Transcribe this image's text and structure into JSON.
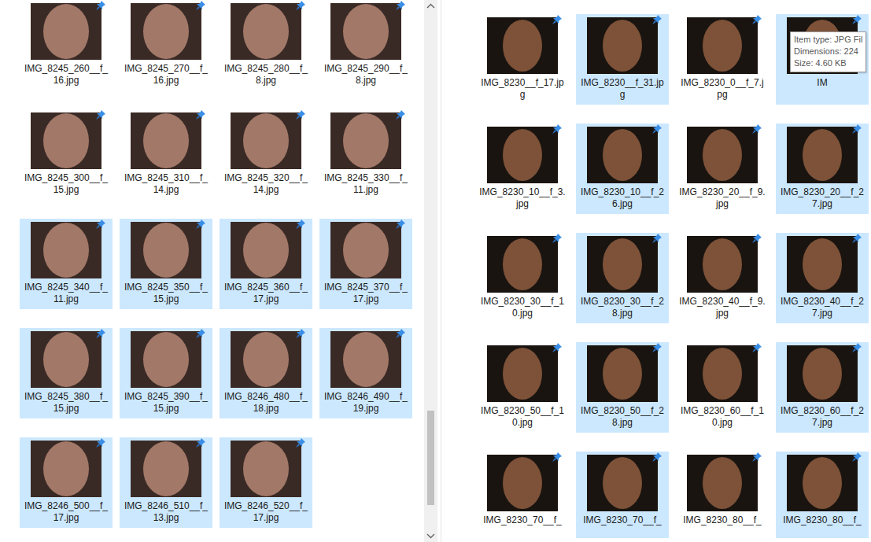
{
  "panes": [
    {
      "files": [
        {
          "name": "IMG_8245_260__f_16.jpg",
          "selected": false
        },
        {
          "name": "IMG_8245_270__f_16.jpg",
          "selected": false
        },
        {
          "name": "IMG_8245_280__f_8.jpg",
          "selected": false
        },
        {
          "name": "IMG_8245_290__f_8.jpg",
          "selected": false
        },
        {
          "name": "IMG_8245_300__f_15.jpg",
          "selected": false
        },
        {
          "name": "IMG_8245_310__f_14.jpg",
          "selected": false
        },
        {
          "name": "IMG_8245_320__f_14.jpg",
          "selected": false
        },
        {
          "name": "IMG_8245_330__f_11.jpg",
          "selected": false
        },
        {
          "name": "IMG_8245_340__f_11.jpg",
          "selected": true
        },
        {
          "name": "IMG_8245_350__f_15.jpg",
          "selected": true
        },
        {
          "name": "IMG_8245_360__f_17.jpg",
          "selected": true
        },
        {
          "name": "IMG_8245_370__f_17.jpg",
          "selected": true
        },
        {
          "name": "IMG_8245_380__f_15.jpg",
          "selected": true
        },
        {
          "name": "IMG_8245_390__f_15.jpg",
          "selected": true
        },
        {
          "name": "IMG_8246_480__f_18.jpg",
          "selected": true
        },
        {
          "name": "IMG_8246_490__f_19.jpg",
          "selected": true
        },
        {
          "name": "IMG_8246_500__f_17.jpg",
          "selected": true
        },
        {
          "name": "IMG_8246_510__f_13.jpg",
          "selected": true
        },
        {
          "name": "IMG_8246_520__f_17.jpg",
          "selected": true
        }
      ]
    },
    {
      "files": [
        {
          "name": "IMG_8230__f_17.jpg",
          "selected": false
        },
        {
          "name": "IMG_8230__f_31.jpg",
          "selected": true
        },
        {
          "name": "IMG_8230_0__f_7.jpg",
          "selected": false
        },
        {
          "name": "IM",
          "selected": true
        },
        {
          "name": "IMG_8230_10__f_3.jpg",
          "selected": false
        },
        {
          "name": "IMG_8230_10__f_26.jpg",
          "selected": true
        },
        {
          "name": "IMG_8230_20__f_9.jpg",
          "selected": false
        },
        {
          "name": "IMG_8230_20__f_27.jpg",
          "selected": true
        },
        {
          "name": "IMG_8230_30__f_10.jpg",
          "selected": false
        },
        {
          "name": "IMG_8230_30__f_28.jpg",
          "selected": true
        },
        {
          "name": "IMG_8230_40__f_9.jpg",
          "selected": false
        },
        {
          "name": "IMG_8230_40__f_27.jpg",
          "selected": true
        },
        {
          "name": "IMG_8230_50__f_10.jpg",
          "selected": false
        },
        {
          "name": "IMG_8230_50__f_28.jpg",
          "selected": true
        },
        {
          "name": "IMG_8230_60__f_10.jpg",
          "selected": false
        },
        {
          "name": "IMG_8230_60__f_27.jpg",
          "selected": true
        },
        {
          "name": "IMG_8230_70__f_",
          "selected": false
        },
        {
          "name": "IMG_8230_70__f_",
          "selected": true
        },
        {
          "name": "IMG_8230_80__f_",
          "selected": false
        },
        {
          "name": "IMG_8230_80__f_",
          "selected": true
        }
      ]
    }
  ],
  "tooltip": {
    "lines": [
      "Item type: JPG Fil",
      "Dimensions: 224",
      "Size: 4.60 KB"
    ]
  }
}
